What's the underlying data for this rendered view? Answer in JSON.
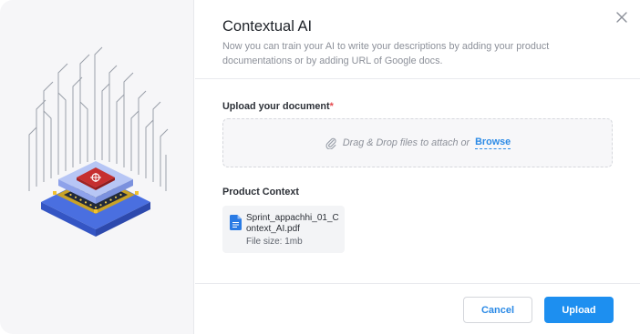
{
  "dialog": {
    "title": "Contextual AI",
    "subtitle": "Now you can train your AI to write your descriptions by adding your product documentations or by adding URL of Google docs."
  },
  "upload": {
    "label": "Upload your document",
    "required_marker": "*",
    "drop_text": "Drag & Drop files to attach or",
    "browse_label": "Browse"
  },
  "product_context": {
    "label": "Product Context",
    "files": [
      {
        "name": "Sprint_appachhi_01_Context_AI.pdf",
        "size": "File size: 1mb"
      }
    ]
  },
  "footer": {
    "cancel_label": "Cancel",
    "upload_label": "Upload"
  },
  "icons": {
    "close": "close-icon",
    "paperclip": "paperclip-icon",
    "file": "document-icon",
    "illustration": "ai-chip-illustration"
  },
  "colors": {
    "accent": "#1d8ff0",
    "link": "#2b8ae6",
    "required": "#e5484d"
  }
}
